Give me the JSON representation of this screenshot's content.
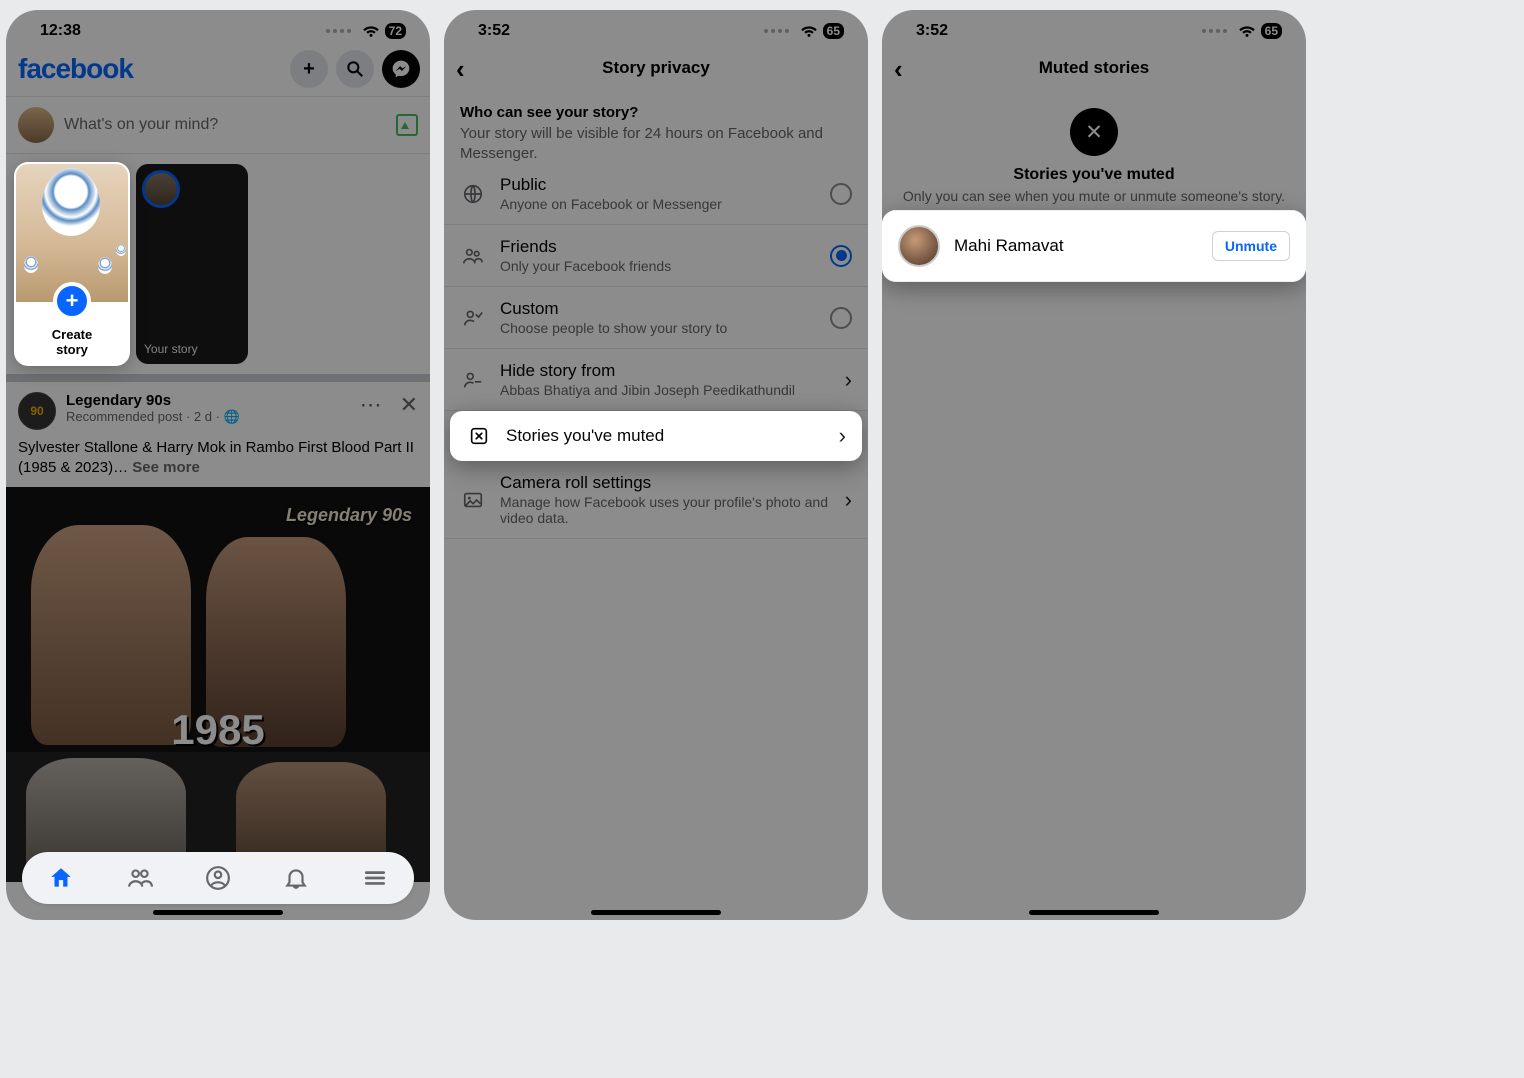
{
  "phone1": {
    "status": {
      "time": "12:38",
      "battery": "72"
    },
    "logo": "facebook",
    "composer_placeholder": "What's on your mind?",
    "create_story": {
      "line1": "Create",
      "line2": "story"
    },
    "your_story_label": "Your story",
    "post": {
      "page_name": "Legendary 90s",
      "page_badge": "90",
      "meta": "Recommended post · 2 d · 🌐",
      "text_prefix": "Sylvester Stallone & Harry Mok in Rambo First Blood Part II (1985 & 2023)… ",
      "see_more": "See more",
      "watermark": "Legendary 90s",
      "year": "1985"
    }
  },
  "phone2": {
    "status": {
      "time": "3:52",
      "battery": "65"
    },
    "title": "Story privacy",
    "section": {
      "heading": "Who can see your story?",
      "desc": "Your story will be visible for 24 hours on Facebook and Messenger."
    },
    "options": {
      "public": {
        "label": "Public",
        "sub": "Anyone on Facebook or Messenger"
      },
      "friends": {
        "label": "Friends",
        "sub": "Only your Facebook friends"
      },
      "custom": {
        "label": "Custom",
        "sub": "Choose people to show your story to"
      },
      "hide": {
        "label": "Hide story from",
        "sub": "Abbas Bhatiya and Jibin Joseph Peedikathundil"
      },
      "muted": {
        "label": "Stories you've muted"
      },
      "camera": {
        "label": "Camera roll settings",
        "sub": "Manage how Facebook uses your profile's photo and video data."
      }
    }
  },
  "phone3": {
    "status": {
      "time": "3:52",
      "battery": "65"
    },
    "title": "Muted stories",
    "hero": {
      "title": "Stories you've muted",
      "desc": "Only you can see when you mute or unmute someone's story."
    },
    "muted_user": {
      "name": "Mahi Ramavat",
      "action": "Unmute"
    }
  }
}
